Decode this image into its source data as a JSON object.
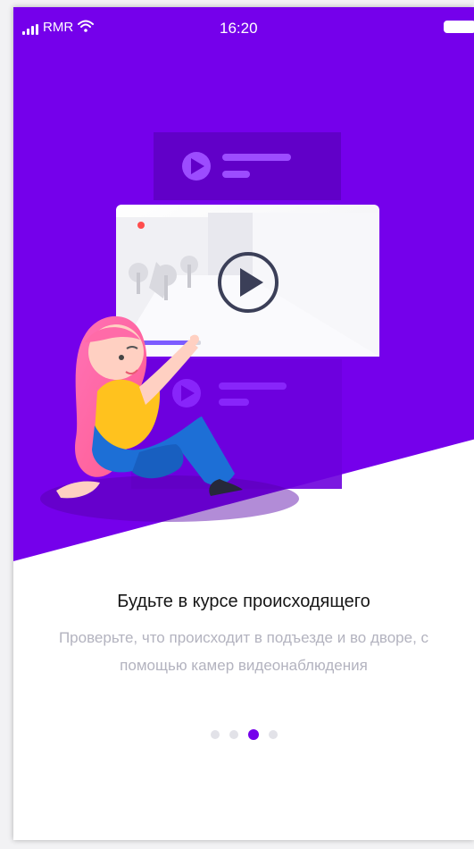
{
  "status_bar": {
    "carrier": "RMR",
    "time": "16:20",
    "signal_icon": "signal-bars-icon",
    "wifi_icon": "wifi-icon",
    "battery_icon": "battery-icon"
  },
  "onboarding": {
    "title": "Будьте в курсе происходящего",
    "description": "Проверьте, что происходит в подъезде и во дворе, с помощью камер видеонаблюдения",
    "page_indicator": {
      "total": 4,
      "current": 3
    }
  },
  "colors": {
    "brand_purple": "#7500eb",
    "title_text": "#161616",
    "description_text": "#b3b3bf",
    "inactive_dot": "#e2e2e8"
  },
  "illustration": {
    "name": "video-surveillance-illustration",
    "play_icon": "play-icon"
  }
}
